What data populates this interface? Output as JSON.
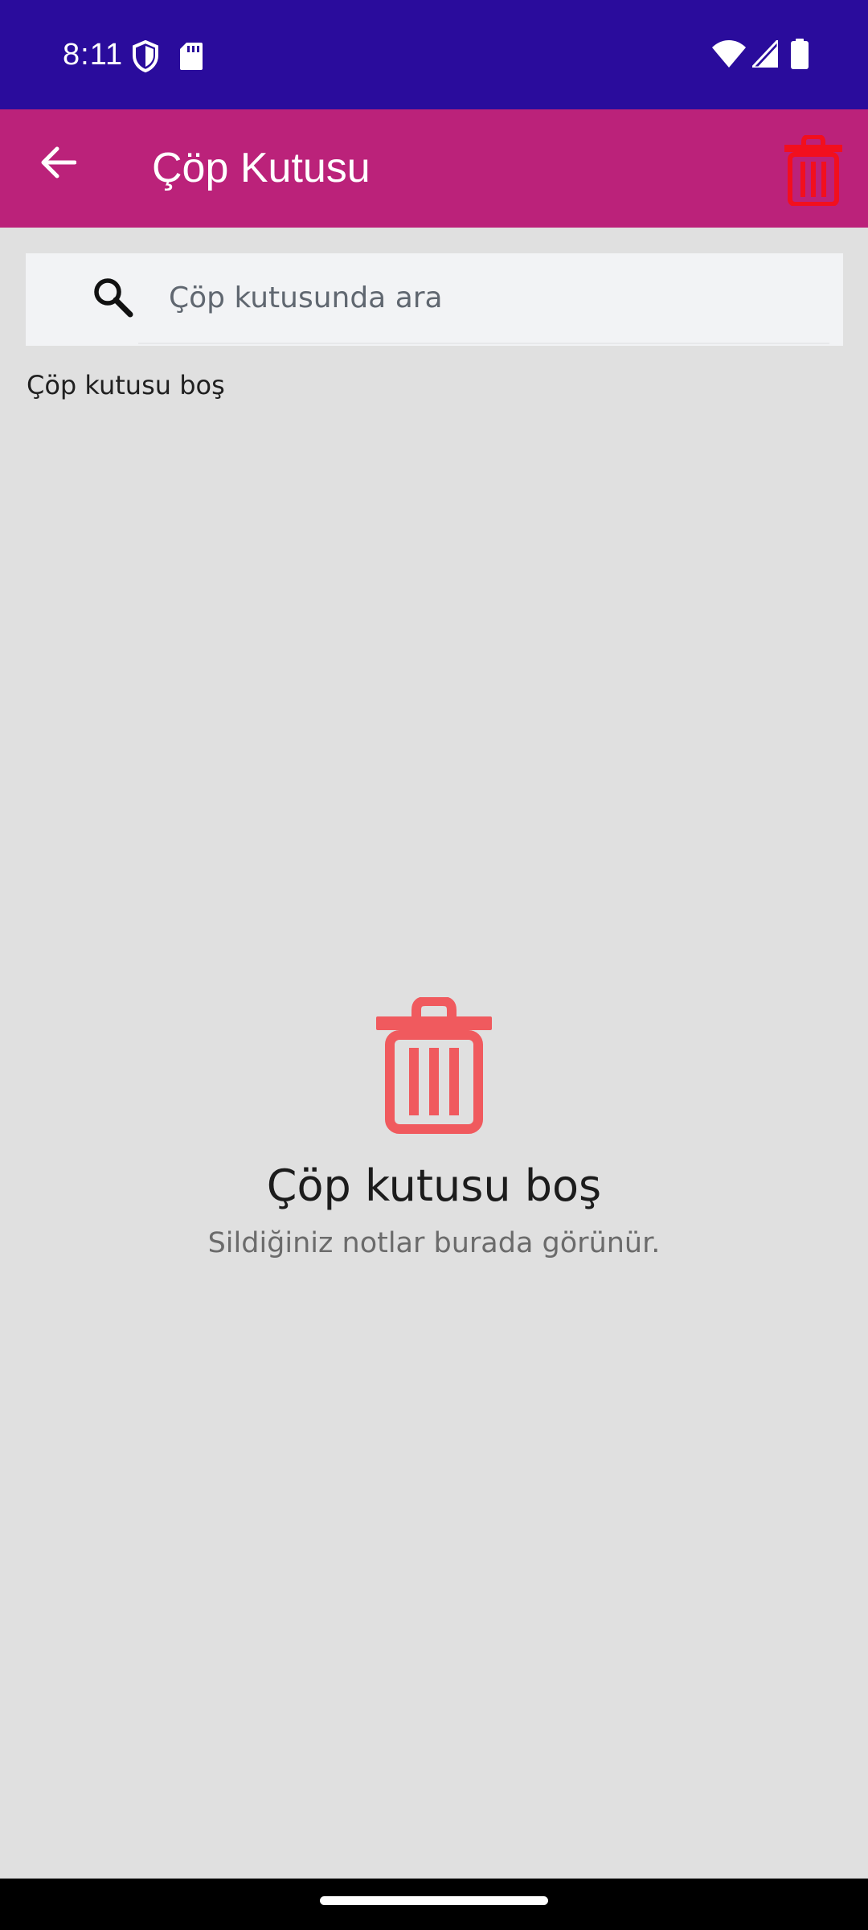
{
  "status_bar": {
    "time": "8:11",
    "left_icons": [
      "shield-icon",
      "sd-card-icon"
    ],
    "right_icons": [
      "wifi-icon",
      "signal-icon",
      "battery-icon"
    ],
    "background": "#2a0c9c"
  },
  "app_bar": {
    "title": "Çöp Kutusu",
    "back_icon": "arrow-back-icon",
    "action_icon": "trash-icon",
    "background": "#bb227a",
    "action_color": "#f20f1e"
  },
  "search": {
    "placeholder": "Çöp kutusunda ara",
    "value": "",
    "icon": "search-icon"
  },
  "section": {
    "label": "Çöp kutusu boş"
  },
  "empty_state": {
    "icon": "trash-icon",
    "icon_color": "#f05a5e",
    "title": "Çöp kutusu boş",
    "subtitle": "Sildiğiniz notlar burada görünür."
  },
  "nav_bar": {
    "handle": "home-gesture-handle"
  }
}
